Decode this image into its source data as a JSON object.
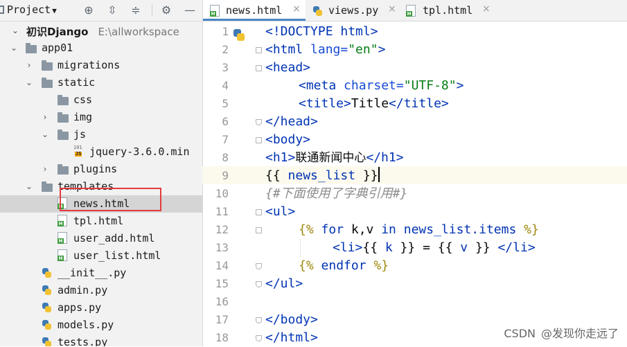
{
  "project_panel": {
    "title": "Project",
    "tree": [
      {
        "label": "初识Django",
        "path": "E:\\allworkspace",
        "type": "folder-root",
        "expanded": true
      },
      {
        "label": "app01",
        "type": "folder",
        "expanded": true
      },
      {
        "label": "migrations",
        "type": "folder",
        "expanded": false
      },
      {
        "label": "static",
        "type": "folder",
        "expanded": true
      },
      {
        "label": "css",
        "type": "folder"
      },
      {
        "label": "img",
        "type": "folder",
        "expanded": false
      },
      {
        "label": "js",
        "type": "folder",
        "expanded": true
      },
      {
        "label": "jquery-3.6.0.min",
        "type": "js"
      },
      {
        "label": "plugins",
        "type": "folder",
        "expanded": false
      },
      {
        "label": "templates",
        "type": "folder",
        "expanded": true
      },
      {
        "label": "news.html",
        "type": "html",
        "selected": true
      },
      {
        "label": "tpl.html",
        "type": "html"
      },
      {
        "label": "user_add.html",
        "type": "html"
      },
      {
        "label": "user_list.html",
        "type": "html"
      },
      {
        "label": "__init__.py",
        "type": "py"
      },
      {
        "label": "admin.py",
        "type": "py"
      },
      {
        "label": "apps.py",
        "type": "py"
      },
      {
        "label": "models.py",
        "type": "py"
      },
      {
        "label": "tests.py",
        "type": "py"
      }
    ],
    "js_icon_text": "101"
  },
  "tabs": [
    {
      "label": "news.html",
      "type": "html",
      "active": true
    },
    {
      "label": "views.py",
      "type": "py",
      "active": false
    },
    {
      "label": "tpl.html",
      "type": "html",
      "active": false
    }
  ],
  "editor": {
    "line_numbers": [
      "1",
      "2",
      "3",
      "4",
      "5",
      "6",
      "7",
      "8",
      "9",
      "10",
      "11",
      "12",
      "13",
      "14",
      "15",
      "16",
      "17",
      "18"
    ],
    "lines": {
      "l1": {
        "a": "<!DOCTYPE html>"
      },
      "l2": {
        "a": "<html",
        "b": " lang=",
        "c": "\"en\"",
        "d": ">"
      },
      "l3": {
        "a": "<head>"
      },
      "l4": {
        "a": "<meta",
        "b": " charset=",
        "c": "\"UTF-8\"",
        "d": ">"
      },
      "l5": {
        "a": "<title>",
        "b": "Title",
        "c": "</title>"
      },
      "l6": {
        "a": "</head>"
      },
      "l7": {
        "a": "<body>"
      },
      "l8": {
        "a": "<h1>",
        "b": "联通新闻中心",
        "c": "</h1>"
      },
      "l9": {
        "a": "{{ ",
        "b": "news_list",
        "c": " }}"
      },
      "l10": {
        "a": "{#下面使用了字典引用#}"
      },
      "l11": {
        "a": "<ul>"
      },
      "l12": {
        "a": "{% ",
        "b": "for",
        "c": " k,v ",
        "d": "in",
        "e": " news_list.items",
        "f": " %}"
      },
      "l13": {
        "a": "<li>",
        "b": "{{ ",
        "c": "k",
        "d": " }} = {{ ",
        "e": "v",
        "f": " }} ",
        "g": "</li>"
      },
      "l14": {
        "a": "{% ",
        "b": "endfor",
        "c": " %}"
      },
      "l15": {
        "a": "</ul>"
      },
      "l17": {
        "a": "</body>"
      },
      "l18": {
        "a": "</html>"
      }
    }
  },
  "watermark": {
    "site": "CSDN",
    "author": "@发现你走远了"
  },
  "colors": {
    "tag": "#0033b3",
    "attr": "#174ad4",
    "string": "#067d17",
    "comment": "#8c8c8c",
    "highlight_box": "#e33b3b",
    "current_line": "#fcfaed"
  }
}
